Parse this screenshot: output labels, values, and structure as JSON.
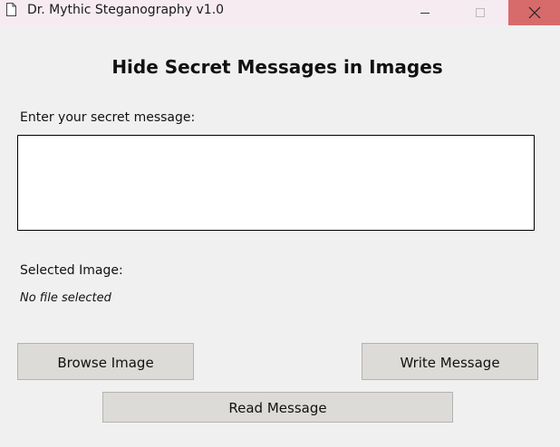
{
  "window": {
    "title": "Dr. Mythic Steganography v1.0",
    "icon": "document-icon",
    "minimize_icon": "–",
    "maximize_icon": "☐",
    "close_icon": "✕"
  },
  "main": {
    "heading": "Hide Secret Messages in Images",
    "message_label": "Enter your secret message:",
    "message_value": "",
    "selected_image_label": "Selected Image:",
    "selected_image_value": "No file selected"
  },
  "buttons": {
    "browse": "Browse Image",
    "write": "Write Message",
    "read": "Read Message"
  },
  "colors": {
    "titlebar": "#f7ebf2",
    "close_hover": "#d76a6a",
    "background": "#f0f0f0",
    "button": "#dddbd8"
  }
}
